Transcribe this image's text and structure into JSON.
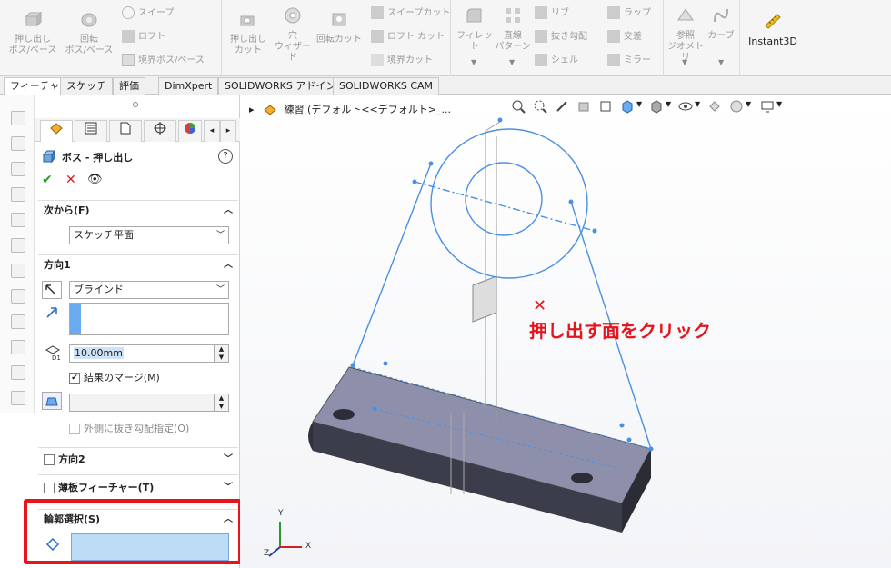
{
  "ribbon": {
    "extrude_boss": "押し出し\nボス/ベース",
    "revolve_boss": "回転\nボス/ベース",
    "sweep": "スイープ",
    "loft": "ロフト",
    "boundary_boss": "境界ボス/ベース",
    "extrude_cut": "押し出し\nカット",
    "hole_wizard": "穴\nウィザード",
    "revolve_cut": "回転カット",
    "sweep_cut": "スイープカット",
    "loft_cut": "ロフト カット",
    "boundary_cut": "境界カット",
    "fillet": "フィレット",
    "linear_pattern": "直線\nパターン",
    "rib": "リブ",
    "draft": "抜き勾配",
    "shell": "シェル",
    "wrap": "ラップ",
    "intersect": "交差",
    "mirror": "ミラー",
    "ref_geometry": "参照\nジオメトリ",
    "curves": "カーブ",
    "instant3d": "Instant3D"
  },
  "tabs": [
    "フィーチャー",
    "スケッチ",
    "評価",
    "DimXpert",
    "SOLIDWORKS アドイン",
    "SOLIDWORKS CAM"
  ],
  "pm": {
    "title": "ボス - 押し出し",
    "help": "?",
    "ok": "✔",
    "cancel": "✕",
    "preview": "👁",
    "from_label": "次から(F)",
    "from_value": "スケッチ平面",
    "dir1_label": "方向1",
    "dir1_type": "ブラインド",
    "depth": "10.00mm",
    "merge_label": "結果のマージ(M)",
    "draft_outward_label": "外側に抜き勾配指定(O)",
    "dir2_label": "方向2",
    "thin_label": "薄板フィーチャー(T)",
    "contour_label": "輪郭選択(S)"
  },
  "viewport": {
    "tree_label": "練習 (デフォルト<<デフォルト>_..."
  },
  "annotation": {
    "text": "押し出す面をクリック",
    "mark": "✕"
  },
  "triad": {
    "x": "X",
    "y": "Y",
    "z": "Z"
  },
  "colors": {
    "accent": "#e8141c",
    "sketch_blue": "#4a90e2",
    "highlight_box": "#bcdcf5"
  }
}
